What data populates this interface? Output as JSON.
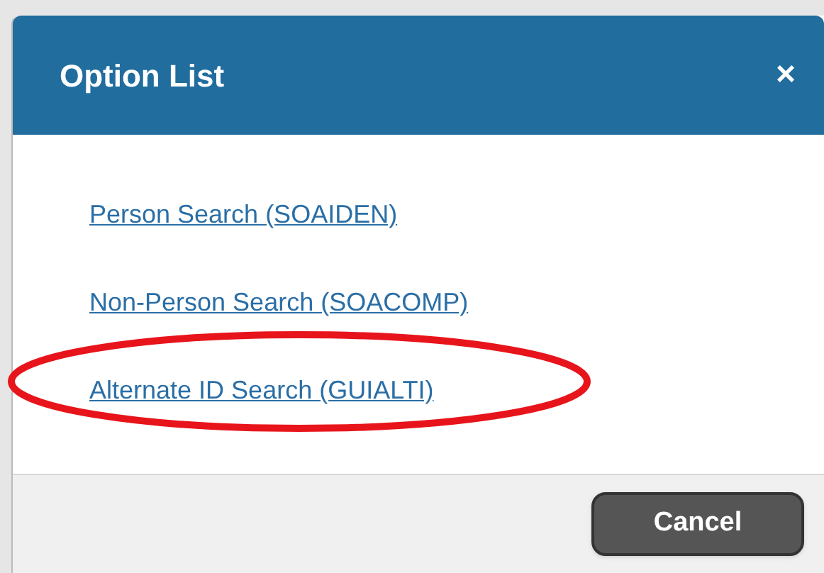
{
  "dialog": {
    "title": "Option List",
    "close": "×"
  },
  "options": [
    {
      "label": "Person Search (SOAIDEN)",
      "circled": false
    },
    {
      "label": "Non-Person Search (SOACOMP)",
      "circled": false
    },
    {
      "label": "Alternate ID Search (GUIALTI)",
      "circled": true
    }
  ],
  "buttons": [
    "Cancel"
  ]
}
